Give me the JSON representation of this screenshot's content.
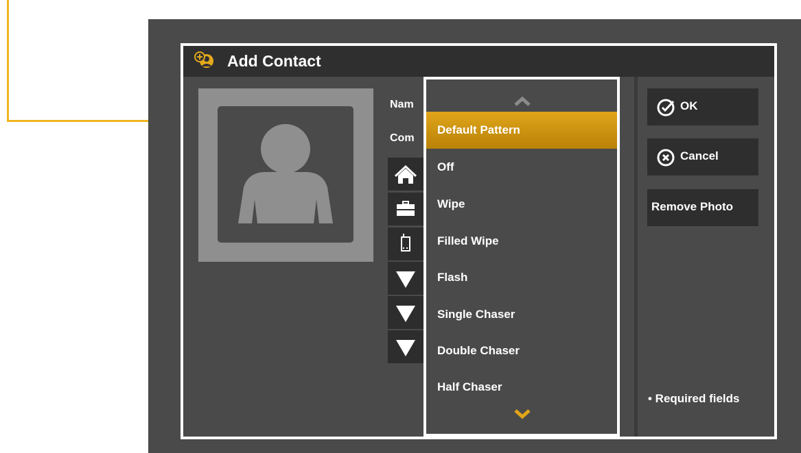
{
  "dialog": {
    "title": "Add Contact"
  },
  "form": {
    "name_label": "Nam",
    "company_label": "Com",
    "phone_icons": [
      "home-icon",
      "briefcase-icon",
      "mobile-phone-icon"
    ],
    "dropdown_arrows": 3
  },
  "pattern_menu": {
    "items": [
      "Default Pattern",
      "Off",
      "Wipe",
      "Filled Wipe",
      "Flash",
      "Single Chaser",
      "Double Chaser",
      "Half Chaser"
    ],
    "selected_index": 0
  },
  "actions": {
    "ok_label": "OK",
    "cancel_label": "Cancel",
    "remove_photo_label": "Remove Photo",
    "required_note": "• Required fields"
  },
  "colors": {
    "accent": "#e0a51a",
    "callout": "#f0b51e",
    "panel": "#4a4a4a",
    "titlebar": "#2f2f2f"
  }
}
